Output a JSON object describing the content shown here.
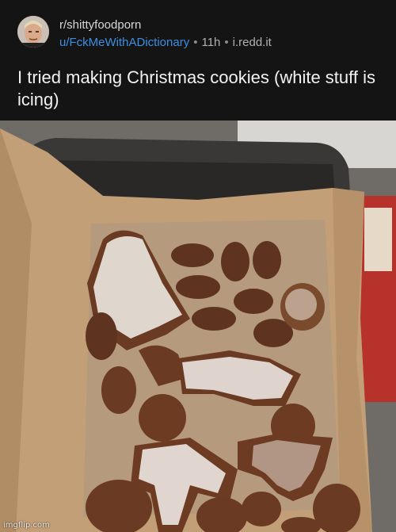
{
  "post": {
    "subreddit": "r/shittyfoodporn",
    "username": "u/FckMeWithADictionary",
    "separator": "•",
    "age": "11h",
    "domain": "i.redd.it",
    "title": "I tried making Christmas cookies (white stuff is icing)"
  },
  "image": {
    "watermark": "imgflip.com"
  },
  "colors": {
    "background": "#141414",
    "username": "#3b8fe3",
    "parchment": "#c7a67f",
    "cookie": "#6b3a22",
    "icing": "#ece8e2"
  }
}
